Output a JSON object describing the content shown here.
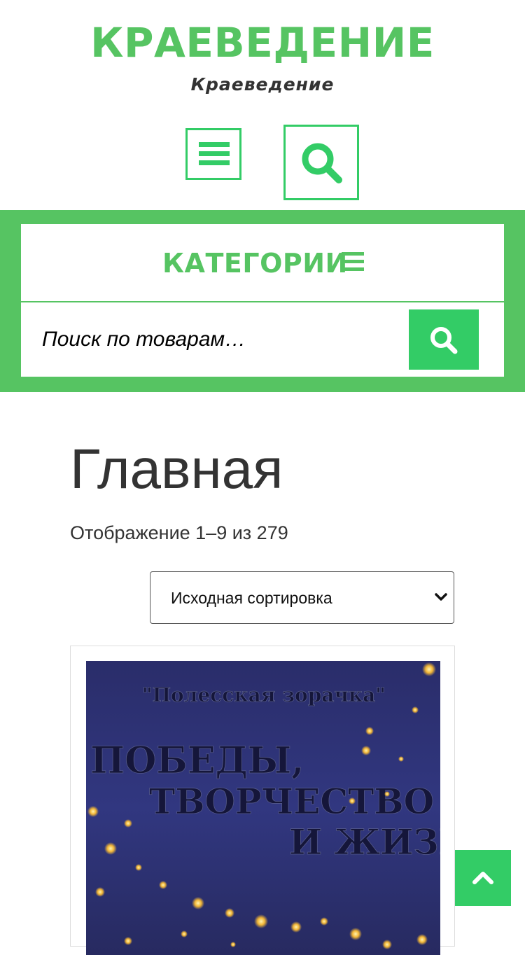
{
  "header": {
    "site_title": "КРАЕВЕДЕНИЕ",
    "site_description": "Краеведение",
    "menu_toggle_icon": "hamburger-icon",
    "search_toggle_icon": "search-icon"
  },
  "category_bar": {
    "label": "КАТЕГОРИИ",
    "icon": "hamburger-icon"
  },
  "product_search": {
    "placeholder": "Поиск по товарам…",
    "value": "",
    "submit_icon": "search-icon"
  },
  "main": {
    "title": "Главная",
    "result_count": "Отображение 1–9 из 279",
    "sort": {
      "selected": "Исходная сортировка"
    }
  },
  "products": [
    {
      "image_lines": [
        "\"Полесская зорачка\"",
        "ПОБЕДЫ,",
        "ТВОРЧЕСТВО",
        "И ЖИЗН"
      ]
    }
  ],
  "back_to_top_icon": "chevron-up-icon",
  "colors": {
    "brand_green": "#56c462",
    "button_green": "#33cc66",
    "text": "#333333",
    "cover_blue": "#2c3170"
  }
}
